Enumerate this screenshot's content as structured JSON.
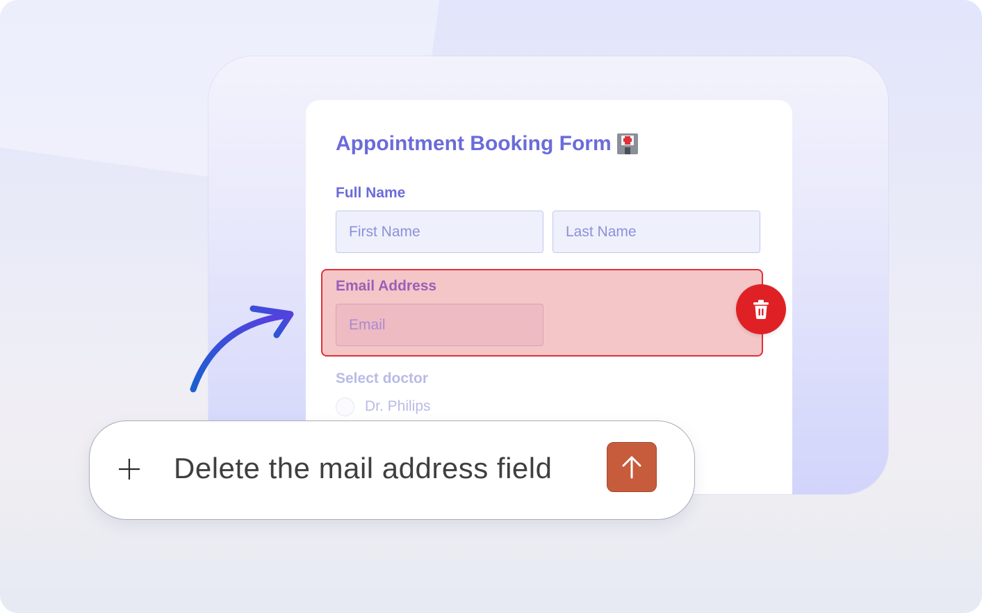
{
  "form": {
    "title": "Appointment Booking Form",
    "title_icon": "hospital-icon",
    "full_name": {
      "label": "Full Name",
      "first_placeholder": "First Name",
      "last_placeholder": "Last Name"
    },
    "email": {
      "label": "Email Address",
      "placeholder": "Email",
      "highlight_color": "#df3036"
    },
    "doctor": {
      "label": "Select doctor",
      "options": [
        "Dr. Philips"
      ]
    }
  },
  "actions": {
    "delete_icon": "trash-icon",
    "delete_color": "#df2126"
  },
  "prompt": {
    "add_icon": "plus-icon",
    "text": "Delete the mail address field",
    "send_icon": "arrow-up-icon",
    "send_color": "#c65c3c"
  },
  "colors": {
    "accent": "#6a6cd9"
  }
}
